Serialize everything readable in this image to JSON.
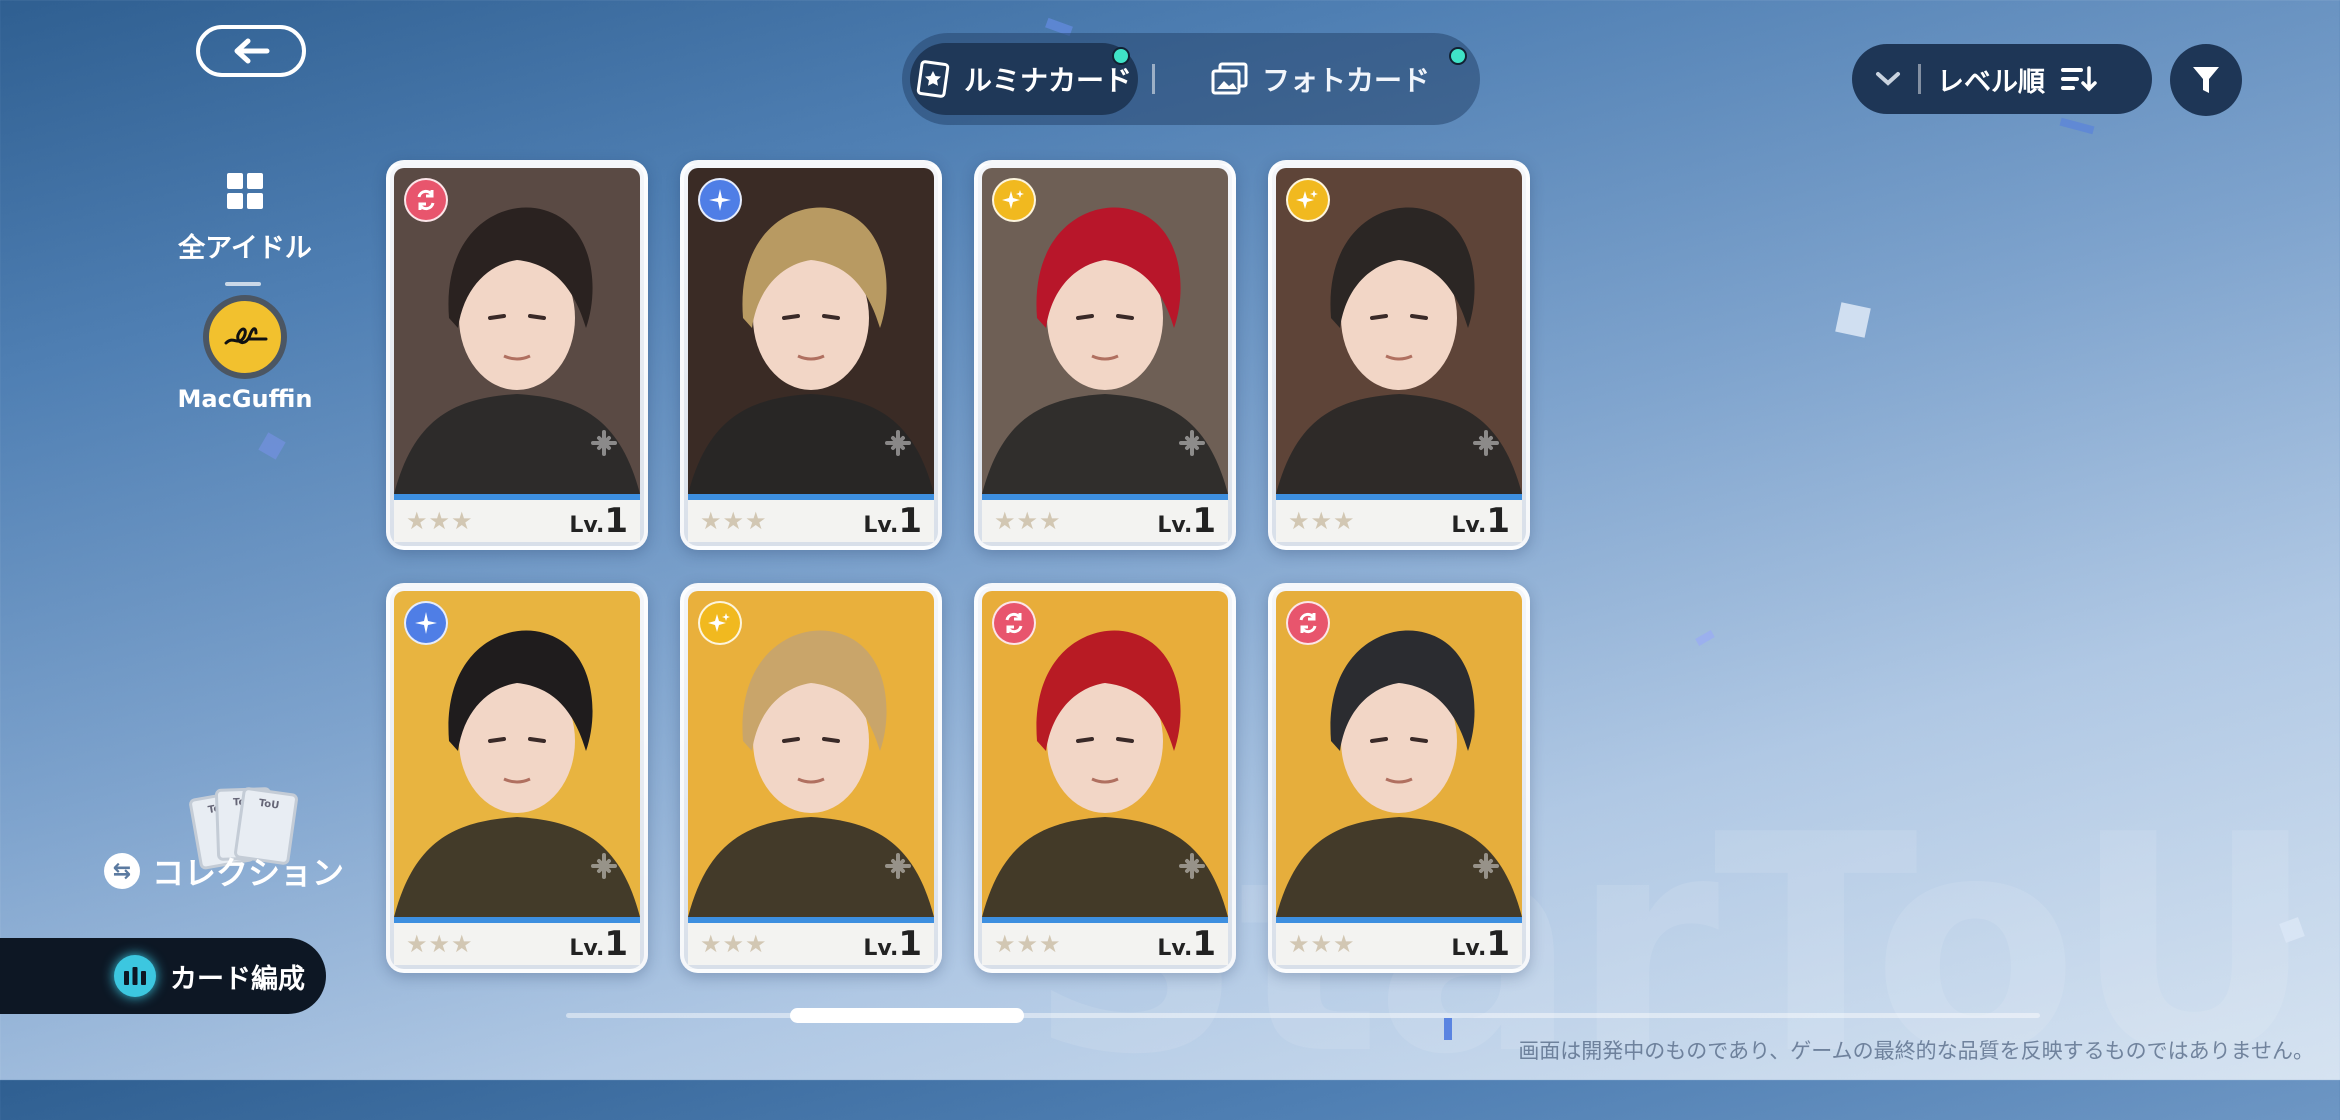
{
  "tabs": [
    {
      "label": "ルミナカード",
      "active": true,
      "notification": true
    },
    {
      "label": "フォトカード",
      "active": false,
      "notification": true
    }
  ],
  "sort": {
    "label": "レベル順"
  },
  "sidebar": {
    "all_label": "全アイドル",
    "group_label": "MacGuffin",
    "collection_label": "コレクション",
    "collection_card_text": "ToU"
  },
  "deck_button_label": "カード編成",
  "cards": [
    {
      "attribute": "red",
      "attr_icon": "swap-icon",
      "bg": "#5a4a44",
      "hair": "#2a2220",
      "level_prefix": "Lv.",
      "level": "1",
      "stars": "★★★"
    },
    {
      "attribute": "blue",
      "attr_icon": "sparkle-icon",
      "bg": "#3a2b25",
      "hair": "#b89a62",
      "level_prefix": "Lv.",
      "level": "1",
      "stars": "★★★"
    },
    {
      "attribute": "yellow",
      "attr_icon": "star-icon",
      "bg": "#6e5f55",
      "hair": "#b8162a",
      "level_prefix": "Lv.",
      "level": "1",
      "stars": "★★★"
    },
    {
      "attribute": "yellow",
      "attr_icon": "star-icon",
      "bg": "#5e4438",
      "hair": "#2b2624",
      "level_prefix": "Lv.",
      "level": "1",
      "stars": "★★★"
    },
    {
      "attribute": "blue",
      "attr_icon": "sparkle-icon",
      "bg": "#e8b440",
      "hair": "#1f1c1d",
      "level_prefix": "Lv.",
      "level": "1",
      "stars": "★★★"
    },
    {
      "attribute": "yellow",
      "attr_icon": "star-icon",
      "bg": "#e9b03c",
      "hair": "#c9a56a",
      "level_prefix": "Lv.",
      "level": "1",
      "stars": "★★★"
    },
    {
      "attribute": "red",
      "attr_icon": "swap-icon",
      "bg": "#e8ad3a",
      "hair": "#b81b24",
      "level_prefix": "Lv.",
      "level": "1",
      "stars": "★★★"
    },
    {
      "attribute": "red",
      "attr_icon": "swap-icon",
      "bg": "#e6ae3c",
      "hair": "#2b2c30",
      "level_prefix": "Lv.",
      "level": "1",
      "stars": "★★★"
    }
  ],
  "scroll_position": 0.15,
  "disclaimer": "画面は開発中のものであり、ゲームの最終的な品質を反映するものではありません。",
  "watermark": "StarToU"
}
